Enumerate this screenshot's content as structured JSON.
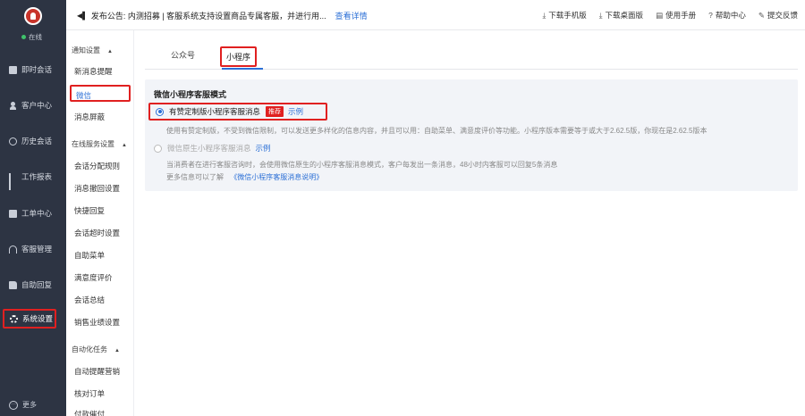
{
  "user": {
    "status": "在线"
  },
  "nav": {
    "items": [
      {
        "label": "即时会话",
        "icon": "chat-icon"
      },
      {
        "label": "客户中心",
        "icon": "user-icon"
      },
      {
        "label": "历史会话",
        "icon": "history-icon"
      },
      {
        "label": "工作报表",
        "icon": "chart-icon"
      },
      {
        "label": "工单中心",
        "icon": "ticket-icon"
      },
      {
        "label": "客服管理",
        "icon": "headset-icon"
      },
      {
        "label": "自助回复",
        "icon": "thumb-icon"
      },
      {
        "label": "系统设置",
        "icon": "gear-icon"
      }
    ],
    "more": "更多"
  },
  "topbar": {
    "notice": "发布公告: 内测招募 | 客服系统支持设置商品专属客服，并进行用...",
    "notice_link": "查看详情",
    "tools": [
      "下载手机版",
      "下载桌面版",
      "使用手册",
      "帮助中心",
      "提交反馈"
    ]
  },
  "submenu": {
    "group1": "通知设置",
    "group1_items": [
      "新消息提醒",
      "微信",
      "消息屏蔽"
    ],
    "group2": "在线服务设置",
    "group2_items": [
      "会话分配规则",
      "消息撤回设置",
      "快捷回复",
      "会话超时设置",
      "自助菜单",
      "满意度评价",
      "会话总结",
      "销售业绩设置"
    ],
    "group3": "自动化任务",
    "group3_items": [
      "自动提醒营销",
      "核对订单",
      "付款催付"
    ]
  },
  "tabs": [
    "公众号",
    "小程序"
  ],
  "section": {
    "title": "微信小程序客服模式",
    "option1": {
      "label": "有赞定制版小程序客服消息",
      "badge": "推荐",
      "link": "示例",
      "desc": "使用有赞定制版，不受到微信限制，可以发送更多样化的信息内容，并且可以用：自助菜单、满意度评价等功能。小程序版本需要等于或大于2.62.5版，你现在是2.62.5版本"
    },
    "option2": {
      "label": "微信原生小程序客服消息",
      "link": "示例",
      "desc": "当消费者在进行客服咨询时，会使用微信原生的小程序客服消息模式，客户每发出一条消息，48小时内客服可以回复5条消息"
    },
    "more_info": "更多信息可以了解",
    "more_link": "《微信小程序客服消息说明》"
  }
}
